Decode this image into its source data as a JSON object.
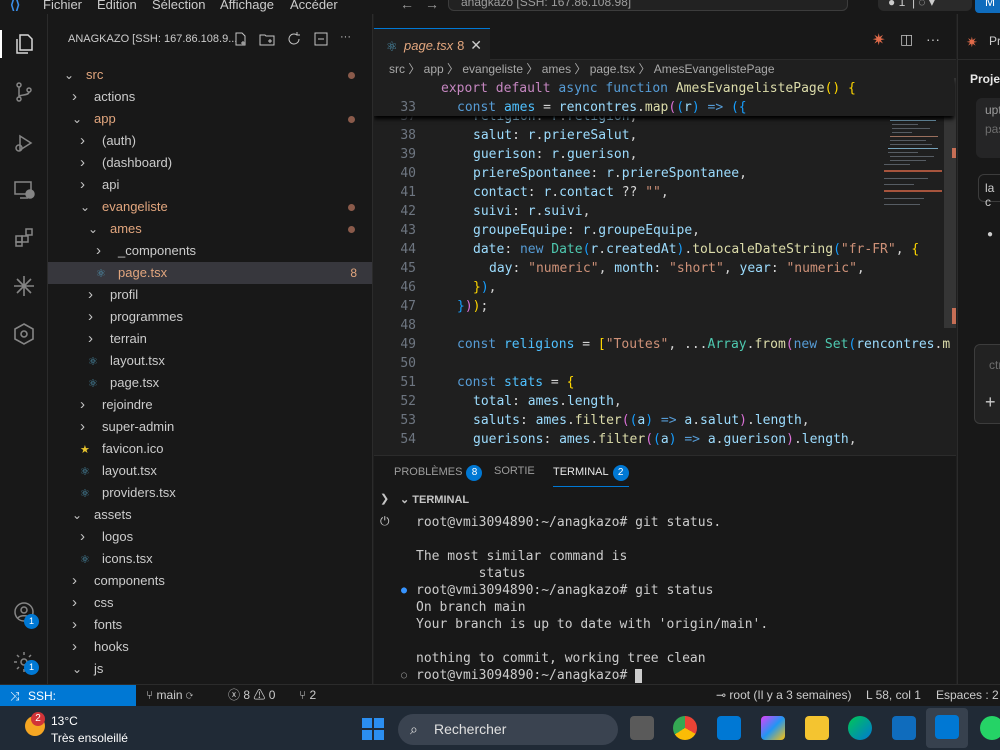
{
  "titlebar": {
    "menus": [
      "Fichier",
      "Edition",
      "Sélection",
      "Affichage",
      "Accéder"
    ],
    "command_center": "anagkazo [SSH: 167.86.108.98]",
    "notifications": "1",
    "account_badge": "M"
  },
  "activity": {
    "accounts_badge": "1",
    "settings_badge": "1"
  },
  "explorer": {
    "title": "ANAGKAZO [SSH: 167.86.108.9...",
    "items": [
      {
        "label": "src",
        "depth": 0,
        "open": true,
        "dot": true
      },
      {
        "label": "actions",
        "depth": 1,
        "open": false
      },
      {
        "label": "app",
        "depth": 1,
        "open": true,
        "dot": true
      },
      {
        "label": "(auth)",
        "depth": 2,
        "open": false
      },
      {
        "label": "(dashboard)",
        "depth": 2,
        "open": false
      },
      {
        "label": "api",
        "depth": 2,
        "open": false
      },
      {
        "label": "evangeliste",
        "depth": 2,
        "open": true,
        "dot": true
      },
      {
        "label": "ames",
        "depth": 3,
        "open": true,
        "dot": true
      },
      {
        "label": "_components",
        "depth": 4,
        "open": false
      },
      {
        "label": "page.tsx",
        "depth": 4,
        "file": "react",
        "selected": true,
        "count": "8"
      },
      {
        "label": "profil",
        "depth": 3,
        "open": false
      },
      {
        "label": "programmes",
        "depth": 3,
        "open": false
      },
      {
        "label": "terrain",
        "depth": 3,
        "open": false
      },
      {
        "label": "layout.tsx",
        "depth": 3,
        "file": "react"
      },
      {
        "label": "page.tsx",
        "depth": 3,
        "file": "react"
      },
      {
        "label": "rejoindre",
        "depth": 2,
        "open": false
      },
      {
        "label": "super-admin",
        "depth": 2,
        "open": false
      },
      {
        "label": "favicon.ico",
        "depth": 2,
        "file": "star"
      },
      {
        "label": "layout.tsx",
        "depth": 2,
        "file": "react"
      },
      {
        "label": "providers.tsx",
        "depth": 2,
        "file": "react"
      },
      {
        "label": "assets",
        "depth": 1,
        "open": true
      },
      {
        "label": "logos",
        "depth": 2,
        "open": false
      },
      {
        "label": "icons.tsx",
        "depth": 2,
        "file": "react"
      },
      {
        "label": "components",
        "depth": 1,
        "open": false
      },
      {
        "label": "css",
        "depth": 1,
        "open": false
      },
      {
        "label": "fonts",
        "depth": 1,
        "open": false
      },
      {
        "label": "hooks",
        "depth": 1,
        "open": false
      },
      {
        "label": "js",
        "depth": 1,
        "open": true
      }
    ]
  },
  "editor": {
    "tab_label": "page.tsx",
    "tab_problems": "8",
    "breadcrumb": "src 〉 app 〉 evangeliste 〉 ames 〉 page.tsx 〉 AmesEvangelistePage",
    "lines": [
      {
        "n": "37",
        "html": "<span class='v'>religion</span><span class='p'>: </span><span class='v'>r</span><span class='p'>.</span><span class='v'>religion</span><span class='p'>,</span>",
        "indent": 2
      },
      {
        "n": "38",
        "html": "<span class='v'>salut</span><span class='p'>: </span><span class='v'>r</span><span class='p'>.</span><span class='v'>priereSalut</span><span class='p'>,</span>",
        "indent": 2
      },
      {
        "n": "39",
        "html": "<span class='v'>guerison</span><span class='p'>: </span><span class='v'>r</span><span class='p'>.</span><span class='v'>guerison</span><span class='p'>,</span>",
        "indent": 2
      },
      {
        "n": "40",
        "html": "<span class='v'>priereSpontanee</span><span class='p'>: </span><span class='v'>r</span><span class='p'>.</span><span class='v'>priereSpontanee</span><span class='p'>,</span>",
        "indent": 2
      },
      {
        "n": "41",
        "html": "<span class='v'>contact</span><span class='p'>: </span><span class='v'>r</span><span class='p'>.</span><span class='v'>contact</span><span class='p'> ?? </span><span class='s'>\"\"</span><span class='p'>,</span>",
        "indent": 2
      },
      {
        "n": "42",
        "html": "<span class='v'>suivi</span><span class='p'>: </span><span class='v'>r</span><span class='p'>.</span><span class='v'>suivi</span><span class='p'>,</span>",
        "indent": 2
      },
      {
        "n": "43",
        "html": "<span class='v'>groupeEquipe</span><span class='p'>: </span><span class='v'>r</span><span class='p'>.</span><span class='v'>groupeEquipe</span><span class='p'>,</span>",
        "indent": 2
      },
      {
        "n": "44",
        "html": "<span class='v'>date</span><span class='p'>: </span><span class='k'>new</span><span class='p'> </span><span class='ty'>Date</span><span class='br3'>(</span><span class='v'>r</span><span class='p'>.</span><span class='v'>createdAt</span><span class='br3'>)</span><span class='p'>.</span><span class='fn'>toLocaleDateString</span><span class='br3'>(</span><span class='s'>\"fr-FR\"</span><span class='p'>, </span><span class='br'>{</span>",
        "indent": 2
      },
      {
        "n": "45",
        "html": "<span class='v'>day</span><span class='p'>: </span><span class='s'>\"numeric\"</span><span class='p'>, </span><span class='v'>month</span><span class='p'>: </span><span class='s'>\"short\"</span><span class='p'>, </span><span class='v'>year</span><span class='p'>: </span><span class='s'>\"numeric\"</span><span class='p'>,</span>",
        "indent": 3
      },
      {
        "n": "46",
        "html": "<span class='br'>}</span><span class='br3'>)</span><span class='p'>,</span>",
        "indent": 2
      },
      {
        "n": "47",
        "html": "<span class='br3'>}</span><span class='br2'>)</span><span class='br'>)</span><span class='p'>;</span>",
        "indent": 1
      },
      {
        "n": "48",
        "html": "",
        "indent": 0
      },
      {
        "n": "49",
        "html": "<span class='k'>const</span><span class='p'> </span><span class='c2'>religions</span><span class='p'> = </span><span class='br'>[</span><span class='s'>\"Toutes\"</span><span class='p'>, ...</span><span class='ty'>Array</span><span class='p'>.</span><span class='fn'>from</span><span class='br2'>(</span><span class='k'>new</span><span class='p'> </span><span class='ty'>Set</span><span class='br3'>(</span><span class='v'>rencontres</span><span class='p'>.</span><span class='fn'>m</span>",
        "indent": 1
      },
      {
        "n": "50",
        "html": "",
        "indent": 0
      },
      {
        "n": "51",
        "html": "<span class='k'>const</span><span class='p'> </span><span class='c2'>stats</span><span class='p'> = </span><span class='br'>{</span>",
        "indent": 1
      },
      {
        "n": "52",
        "html": "<span class='v'>total</span><span class='p'>: </span><span class='v'>ames</span><span class='p'>.</span><span class='v'>length</span><span class='p'>,</span>",
        "indent": 2
      },
      {
        "n": "53",
        "html": "<span class='v'>saluts</span><span class='p'>: </span><span class='v'>ames</span><span class='p'>.</span><span class='fn'>filter</span><span class='br2'>(</span><span class='br3'>(</span><span class='v'>a</span><span class='br3'>)</span><span class='p'> </span><span class='k'>=&gt;</span><span class='p'> </span><span class='v'>a</span><span class='p'>.</span><span class='v'>salut</span><span class='br2'>)</span><span class='p'>.</span><span class='v'>length</span><span class='p'>,</span>",
        "indent": 2
      },
      {
        "n": "54",
        "html": "<span class='v'>guerisons</span><span class='p'>: </span><span class='v'>ames</span><span class='p'>.</span><span class='fn'>filter</span><span class='br2'>(</span><span class='br3'>(</span><span class='v'>a</span><span class='br3'>)</span><span class='p'> </span><span class='k'>=&gt;</span><span class='p'> </span><span class='v'>a</span><span class='p'>.</span><span class='v'>guerison</span><span class='br2'>)</span><span class='p'>.</span><span class='v'>length</span><span class='p'>,</span>",
        "indent": 2
      }
    ],
    "sticky": [
      {
        "n": "",
        "html": "<span class='kc'>export</span><span class='p'> </span><span class='kc'>default</span><span class='p'> </span><span class='k'>async</span><span class='p'> </span><span class='k'>function</span><span class='p'> </span><span class='fn'>AmesEvangelistePage</span><span class='br'>()</span><span class='p'> </span><span class='br'>{</span>",
        "indent": 0
      },
      {
        "n": "33",
        "html": "<span class='k'>const</span><span class='p'> </span><span class='c2'>ames</span><span class='p'> = </span><span class='v'>rencontres</span><span class='p'>.</span><span class='fn'>map</span><span class='br2'>(</span><span class='br3'>(</span><span class='v'>r</span><span class='br3'>)</span><span class='p'> </span><span class='k'>=&gt;</span><span class='p'> </span><span class='br3'>({</span>",
        "indent": 1
      }
    ]
  },
  "panel": {
    "tabs": [
      {
        "label": "PROBLÈMES",
        "badge": "8"
      },
      {
        "label": "SORTIE",
        "badge": ""
      },
      {
        "label": "TERMINAL",
        "badge": "2"
      }
    ],
    "terminal_header": "TERMINAL",
    "terminal_lines": [
      {
        "text": "root@vmi3094890:~/anagkazo# git status.",
        "mark": ""
      },
      {
        "text": "",
        "mark": ""
      },
      {
        "text": "The most similar command is",
        "mark": ""
      },
      {
        "text": "        status",
        "mark": ""
      },
      {
        "text": "root@vmi3094890:~/anagkazo# git status",
        "mark": "blue"
      },
      {
        "text": "On branch main",
        "mark": ""
      },
      {
        "text": "Your branch is up to date with 'origin/main'.",
        "mark": ""
      },
      {
        "text": "",
        "mark": ""
      },
      {
        "text": "nothing to commit, working tree clean",
        "mark": ""
      },
      {
        "text": "root@vmi3094890:~/anagkazo# ",
        "mark": "grey"
      }
    ]
  },
  "chat": {
    "title": "Proje",
    "line1": "upt",
    "line2": "pas",
    "line3": "la c",
    "input": "ctr"
  },
  "status": {
    "remote": "SSH: 167.86.108.98",
    "branch": "main",
    "errors": "8",
    "warnings": "0",
    "ports": "2",
    "blame": "root (Il y a 3 semaines)",
    "position": "L 58, col 1",
    "spaces": "Espaces : 2"
  },
  "taskbar": {
    "temp": "13°C",
    "weather": "Très ensoleillé",
    "weather_badge": "2",
    "search": "Rechercher"
  }
}
